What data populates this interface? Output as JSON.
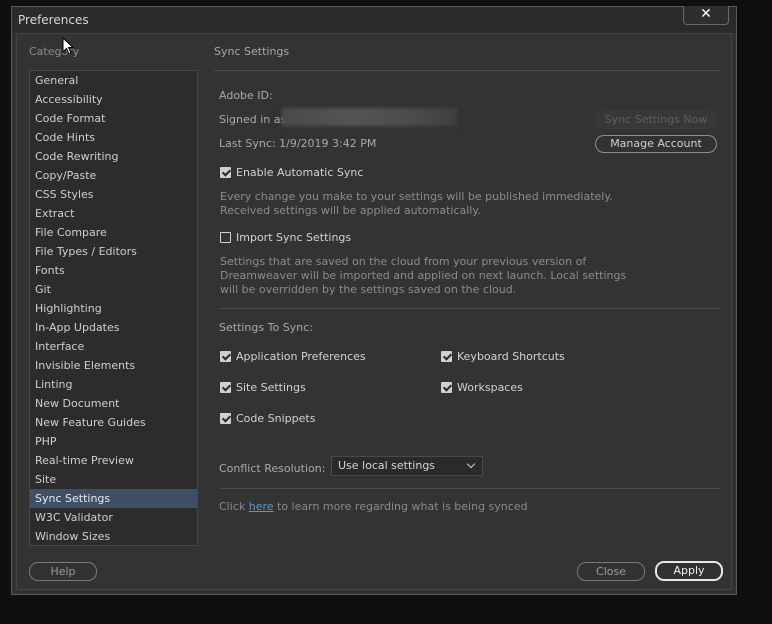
{
  "window": {
    "title": "Preferences",
    "close_glyph": "✕"
  },
  "sidebar": {
    "label": "Category",
    "items": [
      {
        "label": "General"
      },
      {
        "label": "Accessibility"
      },
      {
        "label": "Code Format"
      },
      {
        "label": "Code Hints"
      },
      {
        "label": "Code Rewriting"
      },
      {
        "label": "Copy/Paste"
      },
      {
        "label": "CSS Styles"
      },
      {
        "label": "Extract"
      },
      {
        "label": "File Compare"
      },
      {
        "label": "File Types / Editors"
      },
      {
        "label": "Fonts"
      },
      {
        "label": "Git"
      },
      {
        "label": "Highlighting"
      },
      {
        "label": "In-App Updates"
      },
      {
        "label": "Interface"
      },
      {
        "label": "Invisible Elements"
      },
      {
        "label": "Linting"
      },
      {
        "label": "New Document"
      },
      {
        "label": "New Feature Guides"
      },
      {
        "label": "PHP"
      },
      {
        "label": "Real-time Preview"
      },
      {
        "label": "Site"
      },
      {
        "label": "Sync Settings"
      },
      {
        "label": "W3C Validator"
      },
      {
        "label": "Window Sizes"
      }
    ],
    "selected": "Sync Settings"
  },
  "sync": {
    "section_title": "Sync Settings",
    "adobe_id_label": "Adobe ID:",
    "signed_in_label": "Signed in as",
    "last_sync": "Last Sync: 1/9/2019 3:42 PM",
    "sync_now_button": "Sync Settings Now",
    "manage_account_button": "Manage Account",
    "enable_auto_sync": {
      "label": "Enable Automatic Sync",
      "checked": true
    },
    "auto_sync_desc_1": "Every change you make to your settings will be published immediately.",
    "auto_sync_desc_2": "Received settings will be applied automatically.",
    "import_sync": {
      "label": "Import Sync Settings",
      "checked": false
    },
    "import_desc_1": "Settings that are saved on the cloud from your previous version of",
    "import_desc_2": "Dreamweaver will be imported and applied on next launch. Local settings",
    "import_desc_3": "will be overridden by the settings saved on the cloud.",
    "settings_to_sync_label": "Settings To Sync:",
    "options": {
      "app_prefs": {
        "label": "Application Preferences",
        "checked": true
      },
      "keyboard_shortcuts": {
        "label": "Keyboard Shortcuts",
        "checked": true
      },
      "site_settings": {
        "label": "Site Settings",
        "checked": true
      },
      "workspaces": {
        "label": "Workspaces",
        "checked": true
      },
      "code_snippets": {
        "label": "Code Snippets",
        "checked": true
      }
    },
    "conflict_label": "Conflict Resolution:",
    "conflict_value": "Use local settings",
    "footer_click": "Click",
    "footer_link": "here",
    "footer_rest": "to learn more regarding what is being synced"
  },
  "buttons": {
    "help": "Help",
    "close": "Close",
    "apply": "Apply"
  }
}
